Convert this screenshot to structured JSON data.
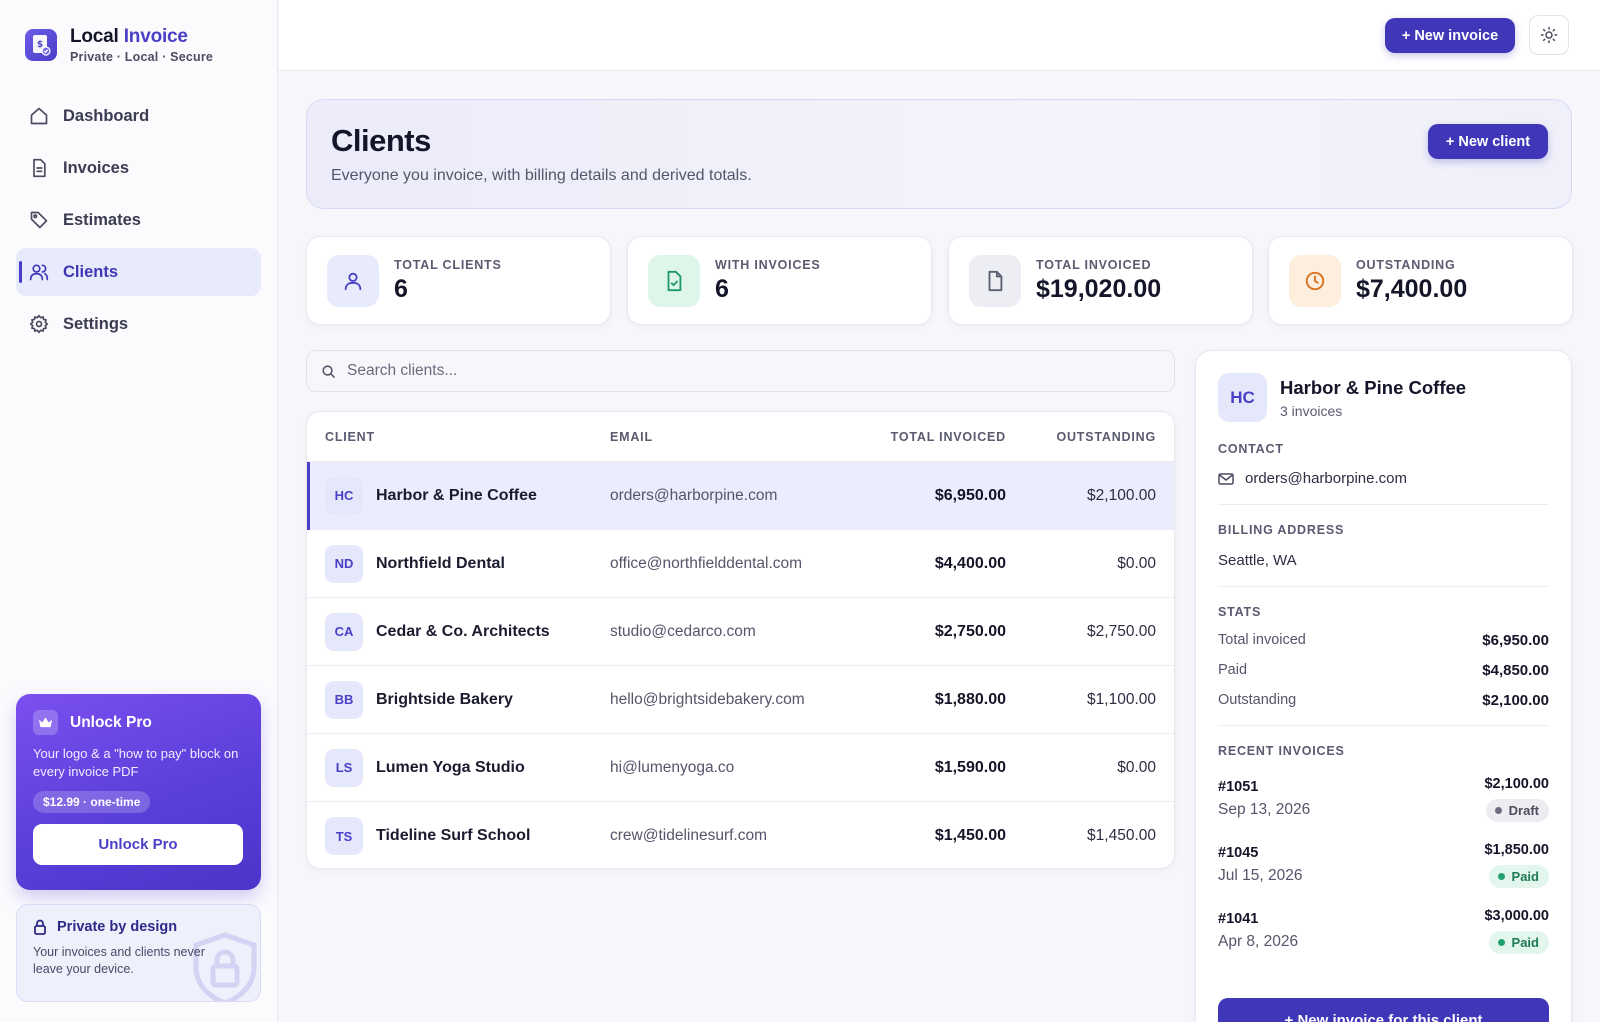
{
  "brand": {
    "name_plain": "Local",
    "name_accent": "Invoice",
    "tagline": "Private · Local · Secure"
  },
  "nav": [
    {
      "label": "Dashboard",
      "icon": "home-icon",
      "active": false
    },
    {
      "label": "Invoices",
      "icon": "file-icon",
      "active": false
    },
    {
      "label": "Estimates",
      "icon": "tag-icon",
      "active": false
    },
    {
      "label": "Clients",
      "icon": "users-icon",
      "active": true
    },
    {
      "label": "Settings",
      "icon": "gear-icon",
      "active": false
    }
  ],
  "promo": {
    "title": "Unlock Pro",
    "text": "Your logo & a \"how to pay\" block on every invoice PDF",
    "price": "$12.99 · one-time",
    "button": "Unlock Pro"
  },
  "privacy": {
    "title": "Private by design",
    "text": "Your invoices and clients never leave your device."
  },
  "topbar": {
    "new_invoice_label": "+ New invoice",
    "theme_icon": "sun-icon"
  },
  "page": {
    "title": "Clients",
    "subtitle": "Everyone you invoice, with billing details and derived totals.",
    "new_client_label": "+ New client"
  },
  "stats": [
    {
      "label": "TOTAL CLIENTS",
      "value": "6",
      "icon": "users-icon",
      "tint": "#e8ebfb",
      "color": "#4a3fc7"
    },
    {
      "label": "WITH INVOICES",
      "value": "6",
      "icon": "file-check-icon",
      "tint": "#def5ea",
      "color": "#1f9a66"
    },
    {
      "label": "TOTAL INVOICED",
      "value": "$19,020.00",
      "icon": "document-icon",
      "tint": "#eceef3",
      "color": "#5a5f70"
    },
    {
      "label": "OUTSTANDING",
      "value": "$7,400.00",
      "icon": "clock-icon",
      "tint": "#fdeedd",
      "color": "#d9701c"
    }
  ],
  "search": {
    "placeholder": "Search clients..."
  },
  "table": {
    "columns": [
      "CLIENT",
      "EMAIL",
      "TOTAL INVOICED",
      "OUTSTANDING"
    ],
    "rows": [
      {
        "initials": "HC",
        "name": "Harbor & Pine Coffee",
        "email": "orders@harborpine.com",
        "total": "$6,950.00",
        "outstanding": "$2,100.00",
        "selected": true
      },
      {
        "initials": "ND",
        "name": "Northfield Dental",
        "email": "office@northfielddental.com",
        "total": "$4,400.00",
        "outstanding": "$0.00",
        "selected": false
      },
      {
        "initials": "CA",
        "name": "Cedar & Co. Architects",
        "email": "studio@cedarco.com",
        "total": "$2,750.00",
        "outstanding": "$2,750.00",
        "selected": false
      },
      {
        "initials": "BB",
        "name": "Brightside Bakery",
        "email": "hello@brightsidebakery.com",
        "total": "$1,880.00",
        "outstanding": "$1,100.00",
        "selected": false
      },
      {
        "initials": "LS",
        "name": "Lumen Yoga Studio",
        "email": "hi@lumenyoga.co",
        "total": "$1,590.00",
        "outstanding": "$0.00",
        "selected": false
      },
      {
        "initials": "TS",
        "name": "Tideline Surf School",
        "email": "crew@tidelinesurf.com",
        "total": "$1,450.00",
        "outstanding": "$1,450.00",
        "selected": false
      }
    ]
  },
  "detail": {
    "initials": "HC",
    "name": "Harbor & Pine Coffee",
    "invoice_count": "3 invoices",
    "contact_label": "CONTACT",
    "email": "orders@harborpine.com",
    "billing_label": "BILLING ADDRESS",
    "address": "Seattle, WA",
    "stats_label": "STATS",
    "stats": [
      {
        "label": "Total invoiced",
        "value": "$6,950.00"
      },
      {
        "label": "Paid",
        "value": "$4,850.00"
      },
      {
        "label": "Outstanding",
        "value": "$2,100.00"
      }
    ],
    "recent_label": "RECENT INVOICES",
    "recent": [
      {
        "number": "#1051",
        "date": "Sep 13, 2026",
        "amount": "$2,100.00",
        "status": "Draft"
      },
      {
        "number": "#1045",
        "date": "Jul 15, 2026",
        "amount": "$1,850.00",
        "status": "Paid"
      },
      {
        "number": "#1041",
        "date": "Apr 8, 2026",
        "amount": "$3,000.00",
        "status": "Paid"
      }
    ],
    "cta": "+ New invoice for this client"
  }
}
